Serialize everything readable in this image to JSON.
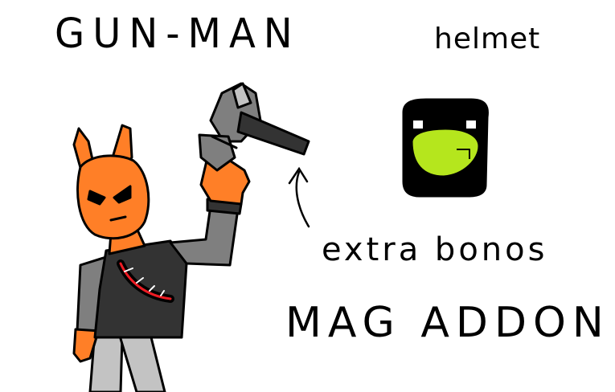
{
  "labels": {
    "title": "GUN-MAN",
    "helmet": "helmet",
    "extra": "extra bonos",
    "mag": "MAG ADDON"
  },
  "colors": {
    "skin": "#ff7f27",
    "dark": "#333333",
    "grey": "#7f7f7f",
    "light_grey": "#c3c3c3",
    "visor": "#b5e61d",
    "red": "#ed1c24",
    "black": "#000000"
  }
}
